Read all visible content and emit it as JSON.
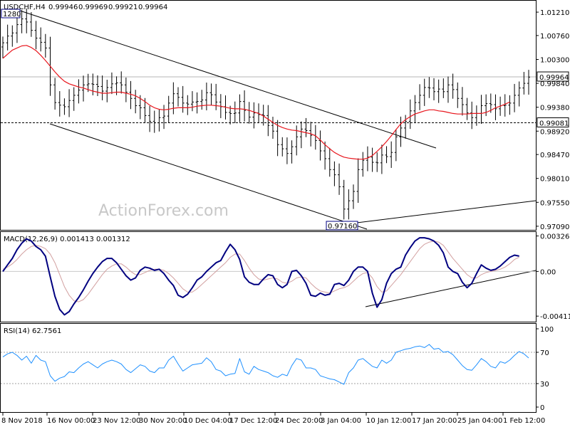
{
  "colors": {
    "background": "#ffffff",
    "bar": "#000000",
    "ma_line": "#e8171e",
    "macd_line": "#000080",
    "signal_line": "#d2a0a0",
    "rsi_line": "#1e90ff",
    "price_label_bg": "#ffffff",
    "label_box_border": "#000080"
  },
  "chart_data": [
    {
      "name": "price",
      "type": "ohlc",
      "title": "USDCHF,H4",
      "ohlc_readout": [
        "0.99946",
        "0.99969",
        "0.99921",
        "0.99964"
      ],
      "ylim": [
        0.9702,
        1.0143
      ],
      "yticks": [
        "1.01210",
        "1.00760",
        "1.00300",
        "0.99840",
        "0.99380",
        "0.98920",
        "0.98470",
        "0.98010",
        "0.97550",
        "0.97090"
      ],
      "current_price_label": "0.99964",
      "current_price": 0.99964,
      "hline_label": "0.99081",
      "hline": 0.99081,
      "annotation_high": "1280",
      "annotation_low": "0.97160",
      "watermark": "ActionForex.com",
      "close_series": [
        1.0062,
        1.0075,
        1.0081,
        1.0097,
        1.0108,
        1.0102,
        1.0086,
        1.0071,
        1.0063,
        1.0052,
        0.9981,
        0.9947,
        0.9942,
        0.9939,
        0.9951,
        0.9961,
        0.9971,
        0.9981,
        0.9983,
        0.9982,
        0.9978,
        0.9969,
        0.9976,
        0.9983,
        0.9985,
        0.9981,
        0.9967,
        0.9955,
        0.9941,
        0.9937,
        0.9922,
        0.9911,
        0.9908,
        0.9918,
        0.9921,
        0.9946,
        0.9964,
        0.9957,
        0.9946,
        0.9944,
        0.9948,
        0.9949,
        0.9952,
        0.9966,
        0.9962,
        0.9948,
        0.9939,
        0.9928,
        0.9926,
        0.9927,
        0.9949,
        0.9932,
        0.9919,
        0.9927,
        0.9924,
        0.9922,
        0.9903,
        0.9892,
        0.9866,
        0.9858,
        0.9849,
        0.9862,
        0.9881,
        0.9896,
        0.9893,
        0.9884,
        0.9874,
        0.9854,
        0.9839,
        0.9818,
        0.9808,
        0.9785,
        0.9742,
        0.9758,
        0.9776,
        0.9818,
        0.9836,
        0.9842,
        0.9832,
        0.9831,
        0.9846,
        0.9843,
        0.9851,
        0.9881,
        0.9898,
        0.9911,
        0.9931,
        0.9947,
        0.9961,
        0.9976,
        0.9975,
        0.9968,
        0.9973,
        0.9968,
        0.9981,
        0.9972,
        0.9955,
        0.9943,
        0.9927,
        0.9918,
        0.9926,
        0.9941,
        0.9945,
        0.9943,
        0.9935,
        0.9941,
        0.9942,
        0.9946,
        0.9961,
        0.9975,
        0.9984,
        0.9996
      ],
      "ma_series": [
        1.0032,
        1.004,
        1.0048,
        1.0052,
        1.0056,
        1.0057,
        1.0053,
        1.0047,
        1.0038,
        1.0028,
        1.0017,
        1.0006,
        0.9996,
        0.9988,
        0.9983,
        0.998,
        0.9977,
        0.9975,
        0.9972,
        0.9969,
        0.9967,
        0.9965,
        0.9965,
        0.9966,
        0.9967,
        0.9967,
        0.9965,
        0.9963,
        0.996,
        0.9955,
        0.9949,
        0.9942,
        0.9937,
        0.9934,
        0.9933,
        0.9934,
        0.9936,
        0.9937,
        0.9937,
        0.9937,
        0.9938,
        0.994,
        0.9941,
        0.9942,
        0.9942,
        0.9941,
        0.994,
        0.9938,
        0.9936,
        0.9935,
        0.9935,
        0.9934,
        0.9932,
        0.9929,
        0.9926,
        0.9921,
        0.9915,
        0.9909,
        0.9903,
        0.9899,
        0.9896,
        0.9894,
        0.9893,
        0.9891,
        0.9889,
        0.9887,
        0.9883,
        0.9875,
        0.9866,
        0.9858,
        0.9851,
        0.9846,
        0.9842,
        0.984,
        0.9839,
        0.9838,
        0.9838,
        0.984,
        0.9845,
        0.9853,
        0.9862,
        0.9872,
        0.9883,
        0.9895,
        0.9906,
        0.9914,
        0.992,
        0.9925,
        0.9928,
        0.9931,
        0.9933,
        0.9933,
        0.9931,
        0.993,
        0.9928,
        0.9926,
        0.9925,
        0.9925,
        0.9925,
        0.9926,
        0.9926,
        0.9926,
        0.9928,
        0.9932,
        0.9937,
        0.994,
        0.9944,
        0.9948
      ]
    },
    {
      "name": "macd",
      "type": "line",
      "title": "MACD(12,26,9) 0.001413 0.001312",
      "ylim": [
        -0.0045,
        0.0035
      ],
      "yticks": [
        "0.003265",
        "0.00",
        "-0.004119"
      ],
      "macd_series": [
        0.0,
        0.0006,
        0.0012,
        0.002,
        0.0026,
        0.003,
        0.0028,
        0.0023,
        0.002,
        0.0014,
        -0.0005,
        -0.0023,
        -0.0035,
        -0.004,
        -0.0037,
        -0.003,
        -0.0024,
        -0.0017,
        -0.0009,
        -0.0002,
        0.0004,
        0.0009,
        0.0012,
        0.0012,
        0.0008,
        0.0002,
        -0.0004,
        -0.0008,
        -0.0006,
        0.0001,
        0.0004,
        0.0003,
        0.0001,
        0.0002,
        -0.0002,
        -0.0008,
        -0.0013,
        -0.0022,
        -0.0024,
        -0.0021,
        -0.0015,
        -0.0008,
        -0.0005,
        0.0,
        0.0004,
        0.0008,
        0.001,
        0.0018,
        0.0025,
        0.002,
        0.0011,
        -0.0005,
        -0.001,
        -0.0012,
        -0.0012,
        -0.0007,
        -0.0003,
        -0.0004,
        -0.0012,
        -0.0015,
        -0.0012,
        0.0,
        0.0001,
        -0.0004,
        -0.0011,
        -0.0022,
        -0.0023,
        -0.002,
        -0.0022,
        -0.0021,
        -0.0012,
        -0.0011,
        -0.0013,
        -0.0008,
        0.0,
        0.0004,
        0.0004,
        0.0,
        -0.002,
        -0.0033,
        -0.0026,
        -0.0011,
        -0.0002,
        0.0002,
        0.0004,
        0.0015,
        0.0022,
        0.0028,
        0.0031,
        0.0031,
        0.003,
        0.0028,
        0.0024,
        0.0017,
        0.0004,
        0.0,
        -0.0002,
        -0.001,
        -0.0015,
        -0.0011,
        -0.0002,
        0.0006,
        0.0003,
        0.0001,
        0.0002,
        0.0005,
        0.0009,
        0.0013,
        0.0015,
        0.00141
      ],
      "signal_series": [
        0.0002,
        0.0004,
        0.0007,
        0.0011,
        0.0016,
        0.002,
        0.0023,
        0.0024,
        0.0023,
        0.0021,
        0.0016,
        0.0008,
        -0.0003,
        -0.0014,
        -0.0022,
        -0.0027,
        -0.0028,
        -0.0026,
        -0.0021,
        -0.0015,
        -0.0009,
        -0.0003,
        0.0002,
        0.0005,
        0.0007,
        0.0007,
        0.0004,
        0.0,
        -0.0003,
        -0.0003,
        -0.0001,
        0.0001,
        0.0002,
        0.0002,
        0.0001,
        -0.0002,
        -0.0006,
        -0.0011,
        -0.0016,
        -0.0019,
        -0.0019,
        -0.0016,
        -0.0012,
        -0.0008,
        -0.0004,
        0.0,
        0.0004,
        0.0008,
        0.0013,
        0.0016,
        0.0016,
        0.001,
        0.0003,
        -0.0003,
        -0.0007,
        -0.0008,
        -0.0007,
        -0.0006,
        -0.0007,
        -0.001,
        -0.0011,
        -0.0009,
        -0.0006,
        -0.0005,
        -0.0006,
        -0.0011,
        -0.0015,
        -0.0018,
        -0.0019,
        -0.002,
        -0.0018,
        -0.0016,
        -0.0015,
        -0.0013,
        -0.0009,
        -0.0005,
        -0.0002,
        -0.0001,
        -0.0006,
        -0.0014,
        -0.0019,
        -0.0018,
        -0.0013,
        -0.0008,
        -0.0003,
        0.0003,
        0.0009,
        0.0015,
        0.0021,
        0.0025,
        0.0027,
        0.0028,
        0.0027,
        0.0024,
        0.0018,
        0.0012,
        0.0007,
        0.0002,
        -0.0003,
        -0.0006,
        -0.0006,
        -0.0003,
        -0.0001,
        0.0,
        0.0001,
        0.0002,
        0.0004,
        0.0007,
        0.0011,
        0.00131
      ]
    },
    {
      "name": "rsi",
      "type": "line",
      "title": "RSI(14) 62.7561",
      "ylim": [
        0,
        100
      ],
      "yticks": [
        "100",
        "70",
        "30",
        "0"
      ],
      "levels": [
        70,
        30
      ],
      "rsi_series": [
        64,
        68,
        70,
        66,
        60,
        65,
        56,
        66,
        60,
        58,
        40,
        33,
        37,
        39,
        45,
        44,
        50,
        55,
        58,
        54,
        50,
        55,
        58,
        60,
        58,
        55,
        48,
        44,
        49,
        54,
        52,
        46,
        44,
        50,
        50,
        60,
        65,
        55,
        46,
        50,
        54,
        55,
        56,
        63,
        58,
        48,
        46,
        40,
        42,
        43,
        62,
        45,
        42,
        52,
        48,
        46,
        44,
        40,
        38,
        42,
        40,
        53,
        62,
        60,
        50,
        50,
        48,
        40,
        38,
        36,
        35,
        32,
        29,
        44,
        50,
        60,
        62,
        57,
        52,
        50,
        60,
        56,
        60,
        70,
        72,
        74,
        75,
        77,
        78,
        76,
        80,
        74,
        75,
        70,
        71,
        67,
        60,
        53,
        48,
        47,
        54,
        62,
        58,
        52,
        50,
        58,
        56,
        60,
        66,
        71,
        68,
        62.76
      ]
    }
  ],
  "x_axis_labels": [
    "8 Nov 2018",
    "16 Nov 00:00",
    "23 Nov 12:00",
    "30 Nov 20:00",
    "10 Dec 04:00",
    "17 Dec 12:00",
    "24 Dec 20:00",
    "3 Jan 04:00",
    "10 Jan 12:00",
    "17 Jan 20:00",
    "25 Jan 04:00",
    "1 Feb 12:00"
  ]
}
